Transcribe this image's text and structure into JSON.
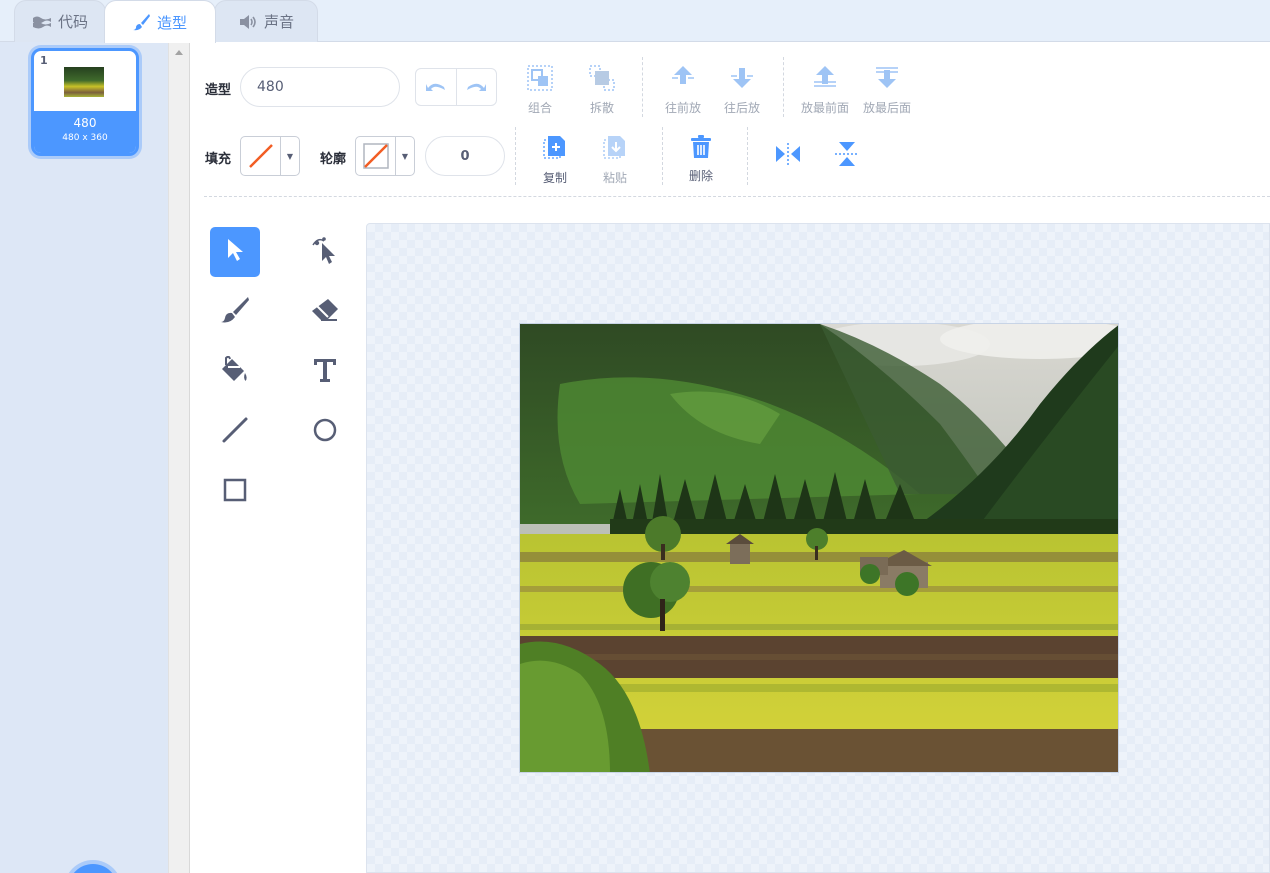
{
  "tabs": [
    {
      "label": "代码",
      "icon": "code-icon"
    },
    {
      "label": "造型",
      "icon": "brush-icon"
    },
    {
      "label": "声音",
      "icon": "speaker-icon"
    }
  ],
  "costumes": [
    {
      "number": "1",
      "name": "480",
      "size": "480 x 360"
    }
  ],
  "toolbar": {
    "costume_label": "造型",
    "costume_name": "480",
    "group_label": "组合",
    "ungroup_label": "拆散",
    "forward_label": "往前放",
    "backward_label": "往后放",
    "front_label": "放最前面",
    "back_label": "放最后面",
    "fill_label": "填充",
    "outline_label": "轮廓",
    "stroke_width": "0",
    "copy_label": "复制",
    "paste_label": "粘贴",
    "delete_label": "删除"
  },
  "tools": [
    "select-icon",
    "reshape-icon",
    "brush-icon",
    "eraser-icon",
    "fill-icon",
    "text-icon",
    "line-icon",
    "circle-icon",
    "rectangle-icon"
  ],
  "colors": {
    "accent": "#4c97ff",
    "no_fill_slash": "#f25d23",
    "text": "#575e75"
  }
}
